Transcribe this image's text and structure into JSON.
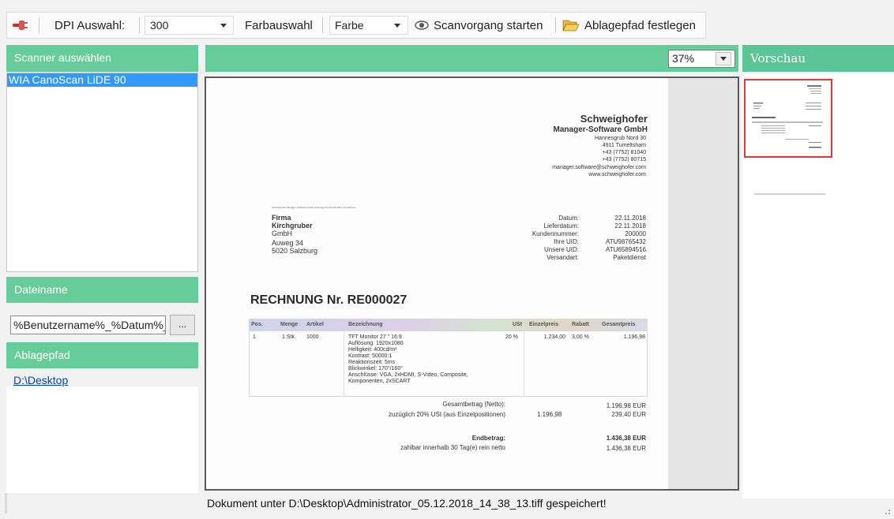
{
  "toolbar": {
    "dpi_label": "DPI Auswahl:",
    "dpi_value": "300",
    "color_label": "Farbauswahl",
    "color_value": "Farbe",
    "scan_button": "Scanvorgang starten",
    "path_button": "Ablagepfad festlegen"
  },
  "left": {
    "scanner_header": "Scanner auswählen",
    "scanner_items": [
      "WIA CanoScan LiDE 90"
    ],
    "filename_header": "Dateiname",
    "filename_value": "%Benutzername%_%Datum%_",
    "browse_label": "...",
    "path_header": "Ablagepfad",
    "path_value": "D:\\Desktop"
  },
  "center": {
    "zoom_value": "37%"
  },
  "preview": {
    "header": "Vorschau"
  },
  "status": "Dokument unter D:\\Desktop\\Administrator_05.12.2018_14_38_13.tiff gespeichert!",
  "document": {
    "sender_name": "Schweighofer",
    "sender_company": "Manager-Software GmbH",
    "sender_address": [
      "Hannesgrub Nord 30",
      "4911 Tumeltsham",
      "+43 (7752) 81040",
      "+43 (7752) 80715",
      "manager.software@schweighofer.com",
      "www.schweighofer.com"
    ],
    "sender_line": "Schweighofer Manager-Software GmbH Hannesgrub Nord 30 4911 Tumeltsham",
    "recipient": [
      "Firma",
      "Kirchgruber",
      "GmbH",
      "Auweg 34",
      "5020 Salzburg"
    ],
    "meta_labels": [
      "Datum:",
      "Lieferdatum:",
      "Kundennummer:",
      "Ihre UID:",
      "Unsere UID:",
      "Versandart:"
    ],
    "meta_values": [
      "22.11.2018",
      "22.11.2018",
      "200000",
      "ATU98765432",
      "ATU65894516",
      "Paketdienst"
    ],
    "invoice_title": "RECHNUNG Nr. RE000027",
    "table_headers": [
      "Pos.",
      "Menge",
      "Artikel",
      "Bezeichnung",
      "USt",
      "Einzelpreis",
      "Rabatt",
      "Gesamtpreis"
    ],
    "row": {
      "pos": "1",
      "qty": "1 Stk",
      "article": "1000",
      "description": [
        "TFT Monitor 27 \" 16:9",
        "Auflösung: 1920x1080",
        "Helligkeit: 400cd/m²",
        "Kontrast: 50000:1",
        "Reaktionszeit: 5ms",
        "Blickwinkel: 170°/160°",
        "Anschlüsse: VGA, 2xHDMI, S-Video, Composite,",
        "Komponenten, 2xSCART"
      ],
      "vat": "20 %",
      "unit_price": "1.234,00",
      "discount": "3,00 %",
      "total": "1.196,98"
    },
    "net_label": "Gesamtbetrag (Netto):",
    "net_value": "1.196,98 EUR",
    "vat_label": "zuzüglich 20% USt (aus Einzelpositionen)",
    "vat_base": "1.196,98",
    "vat_value": "239,40 EUR",
    "end_label": "Endbetrag:",
    "end_value": "1.436,38 EUR",
    "payment_label": "zahlbar innerhalb 30 Tag(e) rein netto",
    "payment_value": "1.436,38 EUR"
  },
  "colors": {
    "header_green": "#66cc99",
    "selection_blue": "#3399ff",
    "thumbnail_border": "#e53935"
  },
  "icons": [
    "power-plug-icon",
    "eye-icon",
    "folder-open-icon",
    "chevron-down-icon"
  ]
}
